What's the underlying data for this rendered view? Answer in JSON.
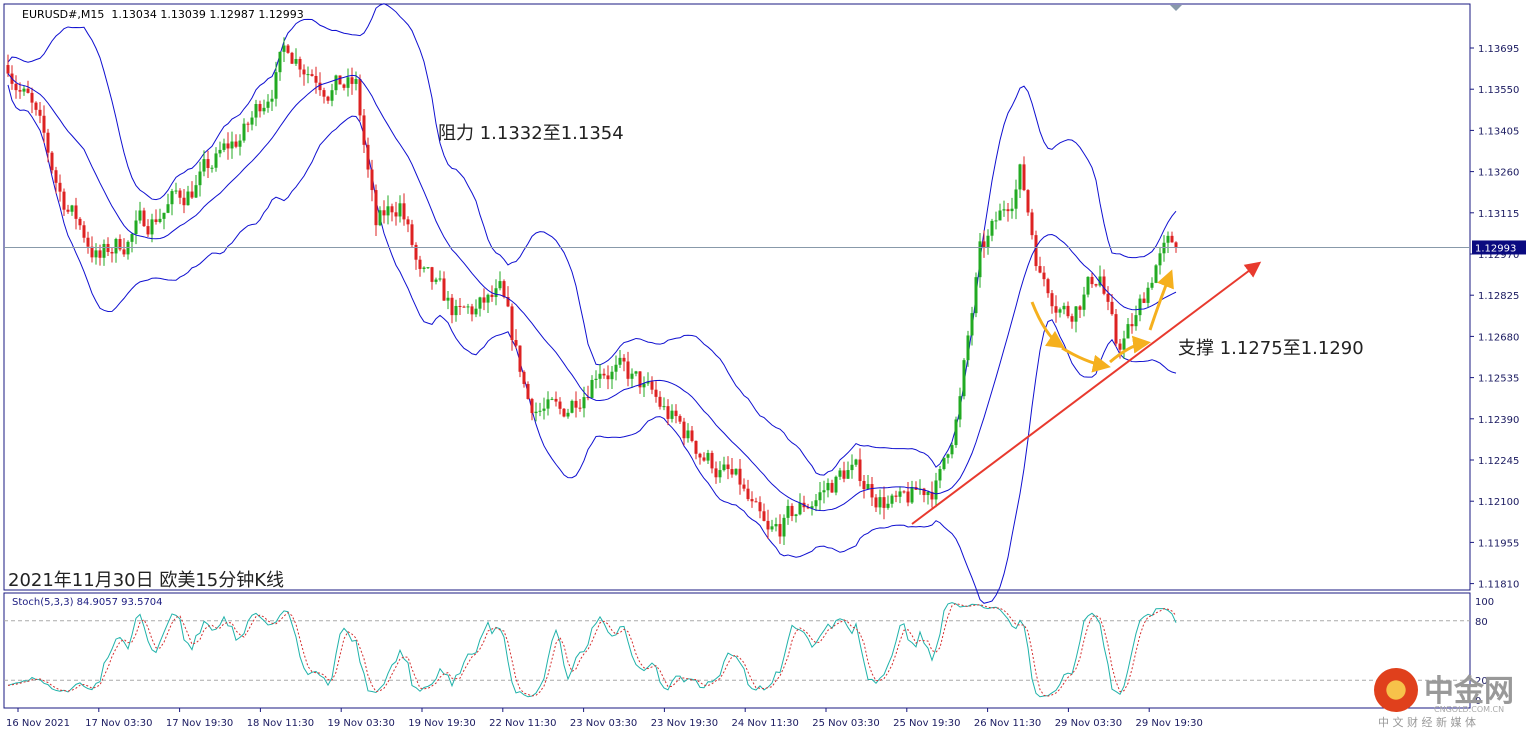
{
  "header": {
    "symbol": "EURUSD#,M15",
    "ohlc": "1.13034 1.13039 1.12987 1.12993"
  },
  "annotations": {
    "resistance": "阻力 1.1332至1.1354",
    "support": "支撑 1.1275至1.1290",
    "caption": "2021年11月30日 欧美15分钟K线"
  },
  "indicator": {
    "label": "Stoch(5,3,3) 84.9057 93.5704",
    "levels": [
      "100",
      "80",
      "20",
      "0"
    ]
  },
  "watermark": {
    "name": "中金网",
    "domain": "CNGOLD.COM.CN",
    "slogan": "中 文 财 经 新 媒 体"
  },
  "colors": {
    "frame": "#1a1a80",
    "band": "#1010d0",
    "up": "#22aa22",
    "down": "#dd2222",
    "trend": "#e83a2e",
    "orange": "#f5b01e",
    "stochMain": "#20b2aa",
    "stochSig": "#d43030"
  },
  "chart_data": {
    "type": "candlestick",
    "title": "EURUSD#,M15",
    "current_price": "1.12993",
    "ylim": [
      1.1175,
      1.1385
    ],
    "y_ticks": [
      "1.13695",
      "1.13550",
      "1.13405",
      "1.13260",
      "1.13115",
      "1.12970",
      "1.12825",
      "1.12680",
      "1.12535",
      "1.12390",
      "1.12245",
      "1.12100",
      "1.11955",
      "1.11810"
    ],
    "x_ticks": [
      "16 Nov 2021",
      "17 Nov 03:30",
      "17 Nov 19:30",
      "18 Nov 11:30",
      "19 Nov 03:30",
      "19 Nov 19:30",
      "22 Nov 11:30",
      "23 Nov 03:30",
      "23 Nov 19:30",
      "24 Nov 11:30",
      "25 Nov 03:30",
      "25 Nov 19:30",
      "26 Nov 11:30",
      "29 Nov 03:30",
      "29 Nov 19:30"
    ],
    "close_path_bar_index": [
      0,
      5,
      13,
      23,
      35,
      48,
      60,
      70,
      80,
      87,
      92,
      98,
      103,
      113,
      123,
      130,
      138,
      148,
      158,
      183,
      190,
      198,
      210,
      223,
      233,
      238,
      243,
      248,
      253,
      258,
      265,
      273,
      277,
      282,
      287,
      292
    ],
    "close_path_price": [
      1.1365,
      1.1351,
      1.1319,
      1.1295,
      1.1309,
      1.1323,
      1.1341,
      1.137,
      1.1358,
      1.1355,
      1.1305,
      1.1316,
      1.1288,
      1.1274,
      1.1281,
      1.1246,
      1.1239,
      1.126,
      1.125,
      1.1214,
      1.1195,
      1.1207,
      1.1221,
      1.1207,
      1.1218,
      1.1246,
      1.1295,
      1.1309,
      1.1327,
      1.1291,
      1.1277,
      1.1291,
      1.1263,
      1.1273,
      1.1295,
      1.13
    ]
  }
}
